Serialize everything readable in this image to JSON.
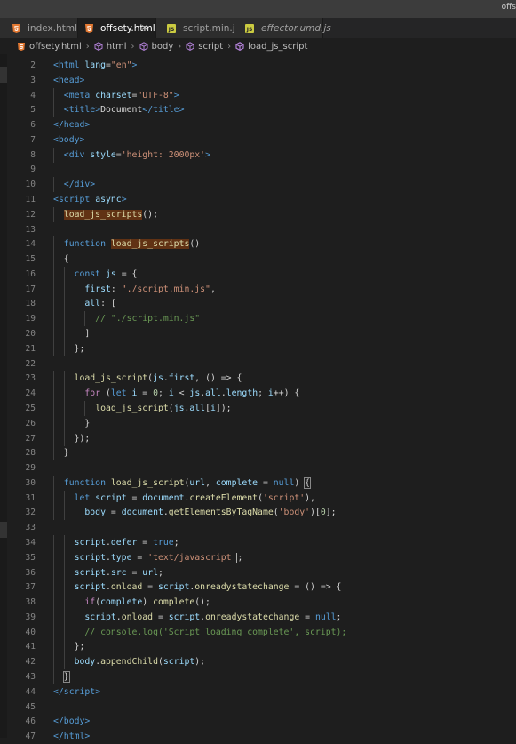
{
  "window": {
    "title_fragment": "offs"
  },
  "tabs": [
    {
      "label": "index.html",
      "icon": "html-file-icon",
      "active": false,
      "italic": false
    },
    {
      "label": "offsety.html",
      "icon": "html-file-icon",
      "active": true,
      "italic": false,
      "close": "×"
    },
    {
      "label": "script.min.js",
      "icon": "js-file-icon",
      "active": false,
      "italic": false
    },
    {
      "label": "effector.umd.js",
      "icon": "js-file-icon",
      "active": false,
      "italic": true
    }
  ],
  "breadcrumb": [
    "offsety.html",
    "html",
    "body",
    "script",
    "load_js_script"
  ],
  "colors": {
    "html_icon": "#e37933",
    "js_icon": "#cbcb41",
    "cube_icon": "#b180d7",
    "bg": "#1e1e1e",
    "highlight": "#613214"
  },
  "lines": [
    {
      "n": "2",
      "indent": 0,
      "tokens": [
        [
          "<",
          "tag"
        ],
        [
          "html",
          "tag"
        ],
        [
          " lang",
          "attr"
        ],
        [
          "=",
          "txt"
        ],
        [
          "\"en\"",
          "str"
        ],
        [
          ">",
          "tag"
        ]
      ]
    },
    {
      "n": "3",
      "indent": 0,
      "tokens": [
        [
          "<",
          "tag"
        ],
        [
          "head",
          "tag"
        ],
        [
          ">",
          "tag"
        ]
      ]
    },
    {
      "n": "4",
      "indent": 1,
      "tokens": [
        [
          "<",
          "tag"
        ],
        [
          "meta",
          "tag"
        ],
        [
          " charset",
          "attr"
        ],
        [
          "=",
          "txt"
        ],
        [
          "\"UTF-8\"",
          "str"
        ],
        [
          ">",
          "tag"
        ]
      ]
    },
    {
      "n": "5",
      "indent": 1,
      "tokens": [
        [
          "<",
          "tag"
        ],
        [
          "title",
          "tag"
        ],
        [
          ">",
          "tag"
        ],
        [
          "Document",
          "txt"
        ],
        [
          "</",
          "tag"
        ],
        [
          "title",
          "tag"
        ],
        [
          ">",
          "tag"
        ]
      ]
    },
    {
      "n": "6",
      "indent": 0,
      "tokens": [
        [
          "</",
          "tag"
        ],
        [
          "head",
          "tag"
        ],
        [
          ">",
          "tag"
        ]
      ]
    },
    {
      "n": "7",
      "indent": 0,
      "tokens": [
        [
          "<",
          "tag"
        ],
        [
          "body",
          "tag"
        ],
        [
          ">",
          "tag"
        ]
      ]
    },
    {
      "n": "8",
      "indent": 1,
      "tokens": [
        [
          "<",
          "tag"
        ],
        [
          "div",
          "tag"
        ],
        [
          " style",
          "attr"
        ],
        [
          "=",
          "txt"
        ],
        [
          "'height: 2000px'",
          "str"
        ],
        [
          ">",
          "tag"
        ]
      ]
    },
    {
      "n": "9",
      "indent": 0,
      "tokens": []
    },
    {
      "n": "10",
      "indent": 1,
      "tokens": [
        [
          "</",
          "tag"
        ],
        [
          "div",
          "tag"
        ],
        [
          ">",
          "tag"
        ]
      ]
    },
    {
      "n": "11",
      "indent": 0,
      "tokens": [
        [
          "<",
          "tag"
        ],
        [
          "script",
          "tag"
        ],
        [
          " async",
          "attr"
        ],
        [
          ">",
          "tag"
        ]
      ]
    },
    {
      "n": "12",
      "indent": 1,
      "tokens": [
        [
          "load_js_scripts",
          "fn hl"
        ],
        [
          "();",
          "txt"
        ]
      ]
    },
    {
      "n": "13",
      "indent": 0,
      "tokens": []
    },
    {
      "n": "14",
      "indent": 1,
      "tokens": [
        [
          "function",
          "kw"
        ],
        [
          " ",
          "txt"
        ],
        [
          "load_js_scripts",
          "fn hl"
        ],
        [
          "()",
          "txt"
        ]
      ]
    },
    {
      "n": "15",
      "indent": 1,
      "tokens": [
        [
          "{",
          "txt"
        ]
      ]
    },
    {
      "n": "16",
      "indent": 2,
      "tokens": [
        [
          "const",
          "kw"
        ],
        [
          " ",
          "txt"
        ],
        [
          "js",
          "var"
        ],
        [
          " = {",
          "txt"
        ]
      ]
    },
    {
      "n": "17",
      "indent": 3,
      "tokens": [
        [
          "first",
          "var"
        ],
        [
          ": ",
          "txt"
        ],
        [
          "\"./script.min.js\"",
          "str"
        ],
        [
          ",",
          "txt"
        ]
      ]
    },
    {
      "n": "18",
      "indent": 3,
      "tokens": [
        [
          "all",
          "var"
        ],
        [
          ": [",
          "txt"
        ]
      ]
    },
    {
      "n": "19",
      "indent": 4,
      "tokens": [
        [
          "// \"./script.min.js\"",
          "com"
        ]
      ]
    },
    {
      "n": "20",
      "indent": 3,
      "tokens": [
        [
          "]",
          "txt"
        ]
      ]
    },
    {
      "n": "21",
      "indent": 2,
      "tokens": [
        [
          "};",
          "txt"
        ]
      ]
    },
    {
      "n": "22",
      "indent": 0,
      "tokens": []
    },
    {
      "n": "23",
      "indent": 2,
      "tokens": [
        [
          "load_js_script",
          "fn"
        ],
        [
          "(",
          "txt"
        ],
        [
          "js",
          "var"
        ],
        [
          ".",
          "txt"
        ],
        [
          "first",
          "var"
        ],
        [
          ", () => {",
          "txt"
        ]
      ]
    },
    {
      "n": "24",
      "indent": 3,
      "tokens": [
        [
          "for",
          "ctrl"
        ],
        [
          " (",
          "txt"
        ],
        [
          "let",
          "kw"
        ],
        [
          " ",
          "txt"
        ],
        [
          "i",
          "var"
        ],
        [
          " = ",
          "txt"
        ],
        [
          "0",
          "num"
        ],
        [
          "; ",
          "txt"
        ],
        [
          "i",
          "var"
        ],
        [
          " < ",
          "txt"
        ],
        [
          "js",
          "var"
        ],
        [
          ".",
          "txt"
        ],
        [
          "all",
          "var"
        ],
        [
          ".",
          "txt"
        ],
        [
          "length",
          "var"
        ],
        [
          "; ",
          "txt"
        ],
        [
          "i",
          "var"
        ],
        [
          "++) {",
          "txt"
        ]
      ]
    },
    {
      "n": "25",
      "indent": 4,
      "tokens": [
        [
          "load_js_script",
          "fn"
        ],
        [
          "(",
          "txt"
        ],
        [
          "js",
          "var"
        ],
        [
          ".",
          "txt"
        ],
        [
          "all",
          "var"
        ],
        [
          "[",
          "txt"
        ],
        [
          "i",
          "var"
        ],
        [
          "]);",
          "txt"
        ]
      ]
    },
    {
      "n": "26",
      "indent": 3,
      "tokens": [
        [
          "}",
          "txt"
        ]
      ]
    },
    {
      "n": "27",
      "indent": 2,
      "tokens": [
        [
          "});",
          "txt"
        ]
      ]
    },
    {
      "n": "28",
      "indent": 1,
      "tokens": [
        [
          "}",
          "txt"
        ]
      ]
    },
    {
      "n": "29",
      "indent": 0,
      "tokens": []
    },
    {
      "n": "30",
      "indent": 1,
      "tokens": [
        [
          "function",
          "kw"
        ],
        [
          " ",
          "txt"
        ],
        [
          "load_js_script",
          "fn"
        ],
        [
          "(",
          "txt"
        ],
        [
          "url",
          "var"
        ],
        [
          ", ",
          "txt"
        ],
        [
          "complete",
          "var"
        ],
        [
          " = ",
          "txt"
        ],
        [
          "null",
          "kw"
        ],
        [
          ") ",
          "txt"
        ],
        [
          "{",
          "txt br"
        ]
      ]
    },
    {
      "n": "31",
      "indent": 2,
      "tokens": [
        [
          "let",
          "kw"
        ],
        [
          " ",
          "txt"
        ],
        [
          "script",
          "var"
        ],
        [
          " = ",
          "txt"
        ],
        [
          "document",
          "var"
        ],
        [
          ".",
          "txt"
        ],
        [
          "createElement",
          "fn"
        ],
        [
          "(",
          "txt"
        ],
        [
          "'script'",
          "str"
        ],
        [
          "),",
          "txt"
        ]
      ]
    },
    {
      "n": "32",
      "indent": 3,
      "tokens": [
        [
          "body",
          "var"
        ],
        [
          " = ",
          "txt"
        ],
        [
          "document",
          "var"
        ],
        [
          ".",
          "txt"
        ],
        [
          "getElementsByTagName",
          "fn"
        ],
        [
          "(",
          "txt"
        ],
        [
          "'body'",
          "str"
        ],
        [
          ")[",
          "txt"
        ],
        [
          "0",
          "num"
        ],
        [
          "];",
          "txt"
        ]
      ]
    },
    {
      "n": "33",
      "indent": 0,
      "tokens": []
    },
    {
      "n": "34",
      "indent": 2,
      "tokens": [
        [
          "script",
          "var"
        ],
        [
          ".",
          "txt"
        ],
        [
          "defer",
          "var"
        ],
        [
          " = ",
          "txt"
        ],
        [
          "true",
          "kw"
        ],
        [
          ";",
          "txt"
        ]
      ]
    },
    {
      "n": "35",
      "indent": 2,
      "tokens": [
        [
          "script",
          "var"
        ],
        [
          ".",
          "txt"
        ],
        [
          "type",
          "var"
        ],
        [
          " = ",
          "txt"
        ],
        [
          "'text/javascript'",
          "str"
        ],
        [
          ";",
          "txt cursor"
        ]
      ]
    },
    {
      "n": "36",
      "indent": 2,
      "tokens": [
        [
          "script",
          "var"
        ],
        [
          ".",
          "txt"
        ],
        [
          "src",
          "var"
        ],
        [
          " = ",
          "txt"
        ],
        [
          "url",
          "var"
        ],
        [
          ";",
          "txt"
        ]
      ]
    },
    {
      "n": "37",
      "indent": 2,
      "tokens": [
        [
          "script",
          "var"
        ],
        [
          ".",
          "txt"
        ],
        [
          "onload",
          "fn"
        ],
        [
          " = ",
          "txt"
        ],
        [
          "script",
          "var"
        ],
        [
          ".",
          "txt"
        ],
        [
          "onreadystatechange",
          "fn"
        ],
        [
          " = () => {",
          "txt"
        ]
      ]
    },
    {
      "n": "38",
      "indent": 3,
      "tokens": [
        [
          "if",
          "ctrl"
        ],
        [
          "(",
          "txt"
        ],
        [
          "complete",
          "var"
        ],
        [
          ") ",
          "txt"
        ],
        [
          "complete",
          "fn"
        ],
        [
          "();",
          "txt"
        ]
      ]
    },
    {
      "n": "39",
      "indent": 3,
      "tokens": [
        [
          "script",
          "var"
        ],
        [
          ".",
          "txt"
        ],
        [
          "onload",
          "fn"
        ],
        [
          " = ",
          "txt"
        ],
        [
          "script",
          "var"
        ],
        [
          ".",
          "txt"
        ],
        [
          "onreadystatechange",
          "fn"
        ],
        [
          " = ",
          "txt"
        ],
        [
          "null",
          "kw"
        ],
        [
          ";",
          "txt"
        ]
      ]
    },
    {
      "n": "40",
      "indent": 3,
      "tokens": [
        [
          "// console.log('Script loading complete', script);",
          "com"
        ]
      ]
    },
    {
      "n": "41",
      "indent": 2,
      "tokens": [
        [
          "};",
          "txt"
        ]
      ]
    },
    {
      "n": "42",
      "indent": 2,
      "tokens": [
        [
          "body",
          "var"
        ],
        [
          ".",
          "txt"
        ],
        [
          "appendChild",
          "fn"
        ],
        [
          "(",
          "txt"
        ],
        [
          "script",
          "var"
        ],
        [
          ");",
          "txt"
        ]
      ]
    },
    {
      "n": "43",
      "indent": 1,
      "tokens": [
        [
          "}",
          "txt br"
        ]
      ]
    },
    {
      "n": "44",
      "indent": 0,
      "tokens": [
        [
          "</",
          "tag"
        ],
        [
          "script",
          "tag"
        ],
        [
          ">",
          "tag"
        ]
      ]
    },
    {
      "n": "45",
      "indent": 0,
      "tokens": []
    },
    {
      "n": "46",
      "indent": 0,
      "tokens": [
        [
          "</",
          "tag"
        ],
        [
          "body",
          "tag"
        ],
        [
          ">",
          "tag"
        ]
      ]
    },
    {
      "n": "47",
      "indent": 0,
      "tokens": [
        [
          "</",
          "tag"
        ],
        [
          "html",
          "tag"
        ],
        [
          ">",
          "tag"
        ]
      ]
    }
  ]
}
